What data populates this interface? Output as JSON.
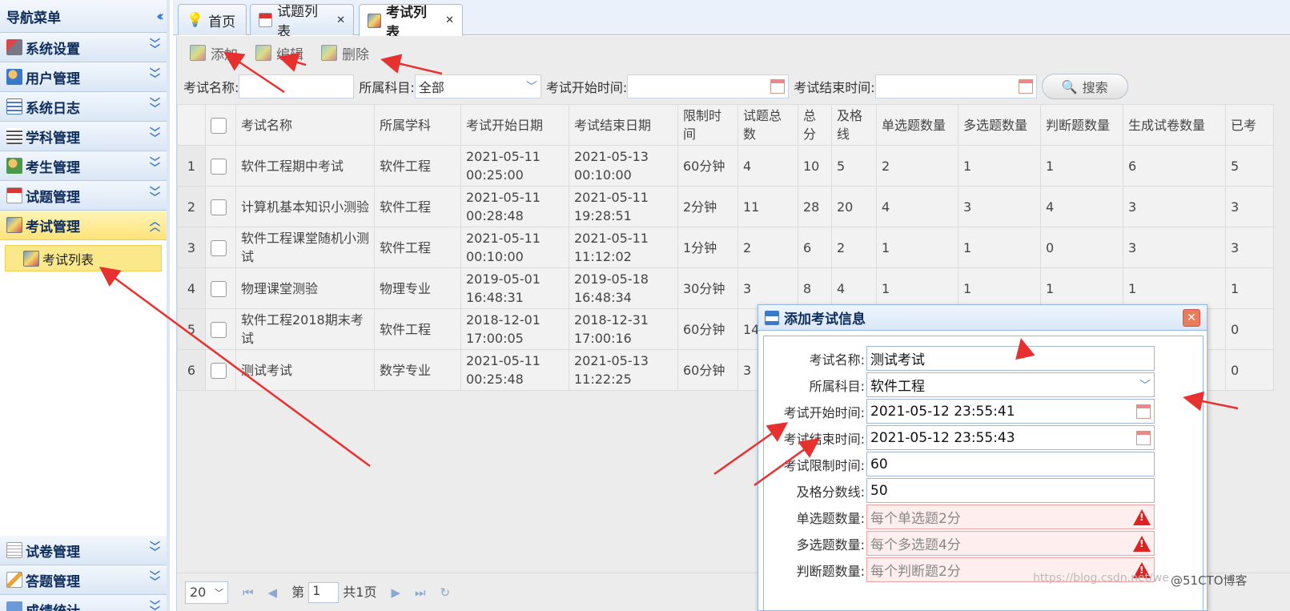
{
  "nav": {
    "title": "导航菜单",
    "sections": [
      {
        "label": "系统设置"
      },
      {
        "label": "用户管理"
      },
      {
        "label": "系统日志"
      },
      {
        "label": "学科管理"
      },
      {
        "label": "考生管理"
      },
      {
        "label": "试题管理"
      },
      {
        "label": "考试管理"
      }
    ],
    "active_sub": "考试列表",
    "bottom": [
      {
        "label": "试卷管理"
      },
      {
        "label": "答题管理"
      },
      {
        "label": "成绩统计"
      }
    ]
  },
  "tabs": [
    {
      "label": "首页"
    },
    {
      "label": "试题列表"
    },
    {
      "label": "考试列表"
    }
  ],
  "toolbar": {
    "add": "添加",
    "edit": "编辑",
    "delete": "删除"
  },
  "search": {
    "name_label": "考试名称:",
    "subject_label": "所属科目:",
    "subject_value": "全部",
    "start_label": "考试开始时间:",
    "end_label": "考试结束时间:",
    "button": "搜索"
  },
  "grid": {
    "headers": [
      "考试名称",
      "所属学科",
      "考试开始日期",
      "考试结束日期",
      "限制时间",
      "试题总数",
      "总分",
      "及格线",
      "单选题数量",
      "多选题数量",
      "判断题数量",
      "生成试卷数量",
      "已考"
    ],
    "rows": [
      {
        "n": "1",
        "c": [
          "软件工程期中考试",
          "软件工程",
          "2021-05-11 00:25:00",
          "2021-05-13 00:10:00",
          "60分钟",
          "4",
          "10",
          "5",
          "2",
          "1",
          "1",
          "6",
          "5"
        ]
      },
      {
        "n": "2",
        "c": [
          "计算机基本知识小测验",
          "软件工程",
          "2021-05-11 00:28:48",
          "2021-05-11 19:28:51",
          "2分钟",
          "11",
          "28",
          "20",
          "4",
          "3",
          "4",
          "3",
          "3"
        ]
      },
      {
        "n": "3",
        "c": [
          "软件工程课堂随机小测试",
          "软件工程",
          "2021-05-11 00:10:00",
          "2021-05-11 11:12:02",
          "1分钟",
          "2",
          "6",
          "2",
          "1",
          "1",
          "0",
          "3",
          "3"
        ]
      },
      {
        "n": "4",
        "c": [
          "物理课堂测验",
          "物理专业",
          "2019-05-01 16:48:31",
          "2019-05-18 16:48:34",
          "30分钟",
          "3",
          "8",
          "4",
          "1",
          "1",
          "1",
          "1",
          "1"
        ]
      },
      {
        "n": "5",
        "c": [
          "软件工程2018期末考试",
          "软件工程",
          "2018-12-01 17:00:05",
          "2018-12-31 17:00:16",
          "60分钟",
          "14",
          "",
          "",
          "",
          "",
          "",
          "",
          "0"
        ]
      },
      {
        "n": "6",
        "c": [
          "测试考试",
          "数学专业",
          "2021-05-11 00:25:48",
          "2021-05-13 11:22:25",
          "60分钟",
          "3",
          "",
          "",
          "",
          "",
          "",
          "",
          "0"
        ]
      }
    ]
  },
  "pager": {
    "size": "20",
    "page_prefix": "第",
    "page": "1",
    "total": "共1页"
  },
  "dialog": {
    "title": "添加考试信息",
    "fields": [
      {
        "label": "考试名称:",
        "value": "测试考试"
      },
      {
        "label": "所属科目:",
        "value": "软件工程"
      },
      {
        "label": "考试开始时间:",
        "value": "2021-05-12 23:55:41"
      },
      {
        "label": "考试结束时间:",
        "value": "2021-05-12 23:55:43"
      },
      {
        "label": "考试限制时间:",
        "value": "60"
      },
      {
        "label": "及格分数线:",
        "value": "50"
      },
      {
        "label": "单选题数量:",
        "placeholder": "每个单选题2分"
      },
      {
        "label": "多选题数量:",
        "placeholder": "每个多选题4分"
      },
      {
        "label": "判断题数量:",
        "placeholder": "每个判断题2分"
      }
    ]
  },
  "watermark": "https://blog.csdn.net/we",
  "watermark2": "@51CTO博客",
  "colors": {
    "accent": "#3a78c8",
    "active": "#fbe88a",
    "arrow": "#e8312f"
  }
}
